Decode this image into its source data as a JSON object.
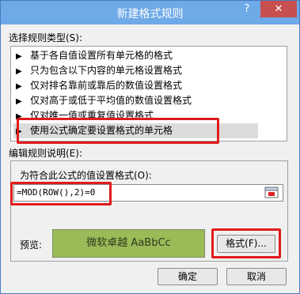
{
  "dialog": {
    "title": "新建格式规则",
    "help_glyph": "?",
    "close_glyph": "✕"
  },
  "rule_type": {
    "label": "选择规则类型(S):",
    "items": [
      {
        "label": "基于各自值设置所有单元格的格式"
      },
      {
        "label": "只为包含以下内容的单元格设置格式"
      },
      {
        "label": "仅对排名靠前或靠后的数值设置格式"
      },
      {
        "label": "仅对高于或低于平均值的数值设置格式"
      },
      {
        "label": "仅对唯一值或重复值设置格式"
      },
      {
        "label": "使用公式确定要设置格式的单元格"
      }
    ],
    "arrow": "▶",
    "selected_index": 5
  },
  "description": {
    "label": "编辑规则说明(E):",
    "formula_label": "为符合此公式的值设置格式(O):",
    "formula_value": "=MOD(ROW(),2)=0",
    "preview_label": "预览:",
    "preview_text": "微软卓越  AaBbCc",
    "preview_color": "#9bbb59",
    "format_button": "格式(F)..."
  },
  "buttons": {
    "ok": "确定",
    "cancel": "取消"
  },
  "colors": {
    "title_bar": "#6ea9e8",
    "close": "#c74f4f",
    "highlight": "#e01b1b"
  }
}
